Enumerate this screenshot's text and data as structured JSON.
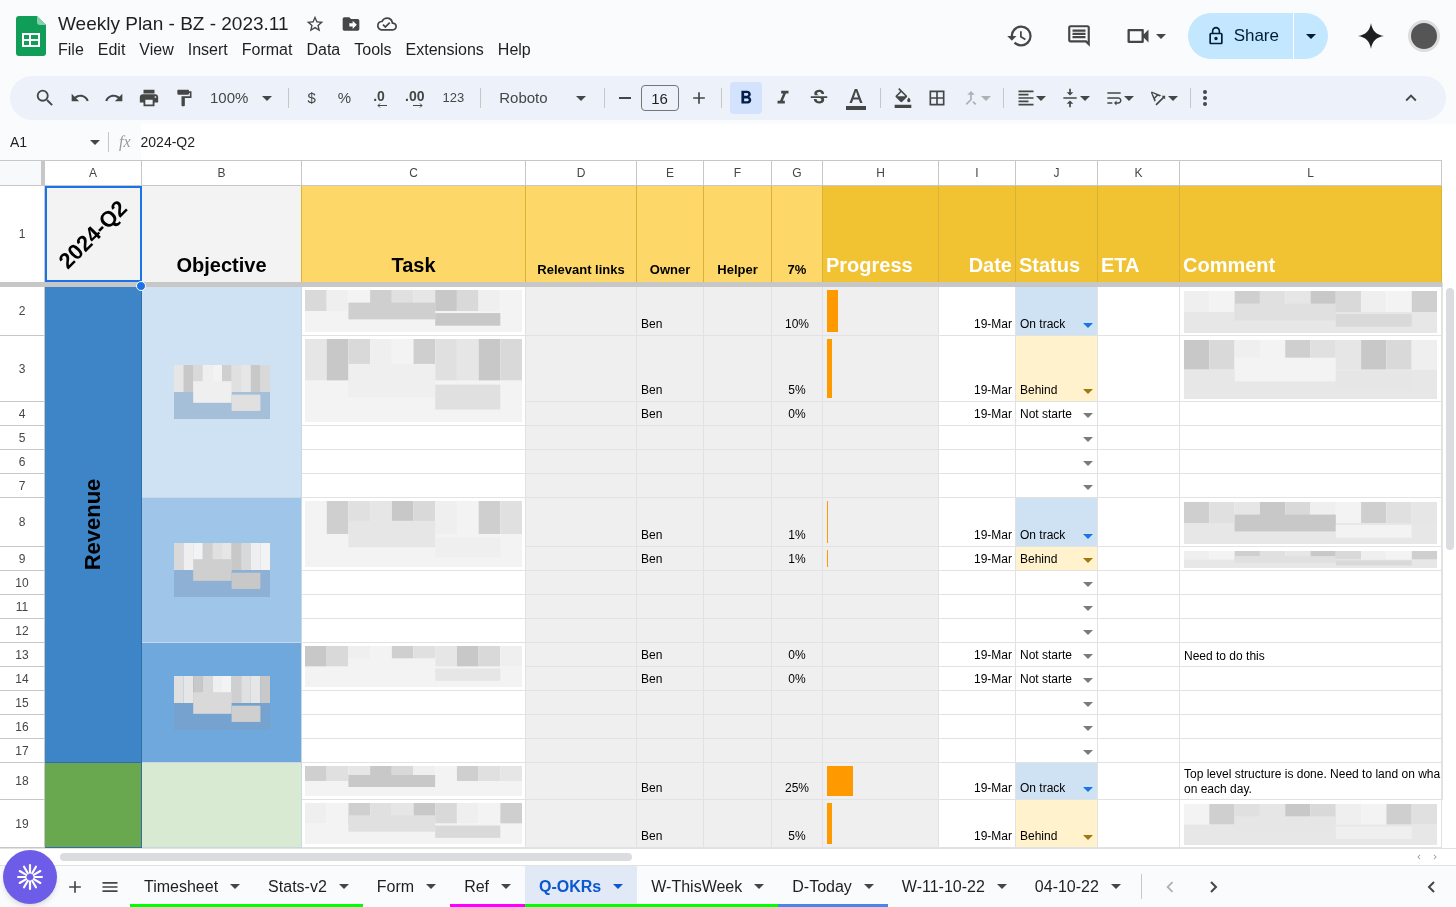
{
  "document": {
    "title": "Weekly Plan - BZ - 2023.11",
    "starred": false
  },
  "menu": [
    "File",
    "Edit",
    "View",
    "Insert",
    "Format",
    "Data",
    "Tools",
    "Extensions",
    "Help"
  ],
  "share_button": {
    "label": "Share"
  },
  "toolbar": {
    "zoom": "100%",
    "currency": "$",
    "percent": "%",
    "decrease_decimal": ".0",
    "increase_decimal": ".00",
    "number_format": "123",
    "font": "Roboto",
    "font_size": "16",
    "bold_active": true
  },
  "formula_bar": {
    "cell_ref": "A1",
    "function_label": "fx",
    "formula": "2024-Q2"
  },
  "header_row_number": "1",
  "columns": [
    "A",
    "B",
    "C",
    "D",
    "E",
    "F",
    "G",
    "H",
    "I",
    "J",
    "K",
    "L"
  ],
  "headers": [
    {
      "label": "2024-Q2",
      "kind": "rotated",
      "selected": true
    },
    {
      "label": "Objective",
      "kind": "plain",
      "selected": false
    },
    {
      "label": "Task",
      "kind": "light_large",
      "selected": false
    },
    {
      "label": "Relevant links",
      "kind": "light",
      "selected": false
    },
    {
      "label": "Owner",
      "kind": "light",
      "selected": false
    },
    {
      "label": "Helper",
      "kind": "light",
      "selected": false
    },
    {
      "label": "7%",
      "kind": "light",
      "selected": false
    },
    {
      "label": "Progress",
      "kind": "dark",
      "selected": false
    },
    {
      "label": "Date",
      "kind": "dark_right",
      "selected": false
    },
    {
      "label": "Status",
      "kind": "dark",
      "selected": false
    },
    {
      "label": "ETA",
      "kind": "dark",
      "selected": false
    },
    {
      "label": "Comment",
      "kind": "dark",
      "selected": false
    }
  ],
  "groups": [
    {
      "label": "Revenue",
      "color": "#3d85c6",
      "objectives": [
        {
          "color": "#cfe2f3",
          "kind": "picture",
          "tasks": [
            {
              "kind": "picture",
              "rows": [
                {
                  "number": "2",
                  "owner": "Ben",
                  "percent": "10%",
                  "level": 0.1,
                  "date": "19-Mar",
                  "status": {
                    "label": "On track",
                    "kind": "on_track"
                  }
                }
              ]
            },
            {
              "kind": "picture",
              "rows": [
                {
                  "number": "3",
                  "owner": "Ben",
                  "percent": "5%",
                  "level": 0.05,
                  "date": "19-Mar",
                  "status": {
                    "label": "Behind",
                    "kind": "behind"
                  }
                },
                {
                  "number": "4",
                  "owner": "Ben",
                  "percent": "0%",
                  "level": 0,
                  "date": "19-Mar",
                  "status": {
                    "label": "Not starte",
                    "kind": "not_started"
                  }
                }
              ]
            },
            {
              "rows": [
                {
                  "number": "5",
                  "status": {
                    "kind": "empty"
                  }
                }
              ]
            },
            {
              "rows": [
                {
                  "number": "6",
                  "status": {
                    "kind": "empty"
                  }
                }
              ]
            },
            {
              "rows": [
                {
                  "number": "7",
                  "status": {
                    "kind": "empty"
                  }
                }
              ]
            }
          ]
        },
        {
          "color": "#9fc5e8",
          "kind": "picture",
          "tasks": [
            {
              "kind": "picture",
              "rows": [
                {
                  "number": "8",
                  "owner": "Ben",
                  "percent": "1%",
                  "level": 0.01,
                  "date": "19-Mar",
                  "status": {
                    "label": "On track",
                    "kind": "on_track"
                  }
                },
                {
                  "number": "9",
                  "owner": "Ben",
                  "percent": "1%",
                  "level": 0.01,
                  "date": "19-Mar",
                  "status": {
                    "label": "Behind",
                    "kind": "behind"
                  }
                }
              ]
            },
            {
              "rows": [
                {
                  "number": "10",
                  "status": {
                    "kind": "empty"
                  }
                }
              ]
            },
            {
              "rows": [
                {
                  "number": "11",
                  "status": {
                    "kind": "empty"
                  }
                }
              ]
            },
            {
              "rows": [
                {
                  "number": "12",
                  "status": {
                    "kind": "empty"
                  }
                }
              ]
            }
          ]
        },
        {
          "color": "#6fa8dc",
          "kind": "picture",
          "tasks": [
            {
              "kind": "picture",
              "rows": [
                {
                  "number": "13",
                  "owner": "Ben",
                  "percent": "0%",
                  "level": 0,
                  "date": "19-Mar",
                  "status": {
                    "label": "Not starte",
                    "kind": "not_started"
                  },
                  "comment": {
                    "text": "Need to do this"
                  }
                },
                {
                  "number": "14",
                  "owner": "Ben",
                  "percent": "0%",
                  "level": 0,
                  "date": "19-Mar",
                  "status": {
                    "label": "Not starte",
                    "kind": "not_started"
                  }
                }
              ]
            },
            {
              "rows": [
                {
                  "number": "15",
                  "status": {
                    "kind": "empty"
                  }
                }
              ]
            },
            {
              "rows": [
                {
                  "number": "16",
                  "status": {
                    "kind": "empty"
                  }
                }
              ]
            },
            {
              "rows": [
                {
                  "number": "17",
                  "status": {
                    "kind": "empty"
                  }
                }
              ]
            }
          ]
        }
      ]
    },
    {
      "color": "#6aa84f",
      "objectives": [
        {
          "color": "#d9ead3",
          "tasks": [
            {
              "kind": "picture",
              "rows": [
                {
                  "number": "18",
                  "owner": "Ben",
                  "percent": "25%",
                  "level": 0.25,
                  "date": "19-Mar",
                  "status": {
                    "label": "On track",
                    "kind": "on_track"
                  },
                  "comment": {
                    "text": "Top level structure is done. Need to land on wha\non each day."
                  }
                }
              ]
            },
            {
              "kind": "picture",
              "rows": [
                {
                  "number": "19",
                  "owner": "Ben",
                  "percent": "5%",
                  "level": 0.05,
                  "date": "19-Mar",
                  "status": {
                    "label": "Behind",
                    "kind": "behind"
                  }
                }
              ]
            }
          ]
        }
      ]
    }
  ],
  "sheet_tabs": [
    {
      "label": "Timesheet",
      "color": "#00ff00",
      "selected": false
    },
    {
      "label": "Stats-v2",
      "color": "#00ff00",
      "selected": false
    },
    {
      "label": "Form",
      "selected": false
    },
    {
      "label": "Ref",
      "color": "#ff00ff",
      "selected": false
    },
    {
      "label": "Q-OKRs",
      "color": "#00ff00",
      "selected": true
    },
    {
      "label": "W-ThisWeek",
      "color": "#00ff00",
      "selected": false
    },
    {
      "label": "D-Today",
      "color": "#4a86e8",
      "selected": false
    },
    {
      "label": "W-11-10-22",
      "selected": false
    },
    {
      "label": "04-10-22",
      "selected": false
    }
  ]
}
